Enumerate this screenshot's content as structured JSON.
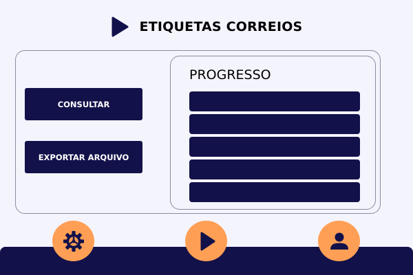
{
  "header": {
    "title": "ETIQUETAS CORREIOS",
    "logo_icon": "play-triangle-icon"
  },
  "actions": {
    "consultar_label": "CONSULTAR",
    "exportar_label": "EXPORTAR ARQUIVO"
  },
  "progress": {
    "title": "PROGRESSO",
    "bars": 5
  },
  "bottom_nav": {
    "items": [
      {
        "icon": "gear-icon"
      },
      {
        "icon": "play-icon"
      },
      {
        "icon": "user-icon"
      }
    ]
  },
  "colors": {
    "background": "#f4f4fd",
    "primary": "#12114a",
    "accent": "#ff9f55",
    "border": "#8a8aa0"
  }
}
